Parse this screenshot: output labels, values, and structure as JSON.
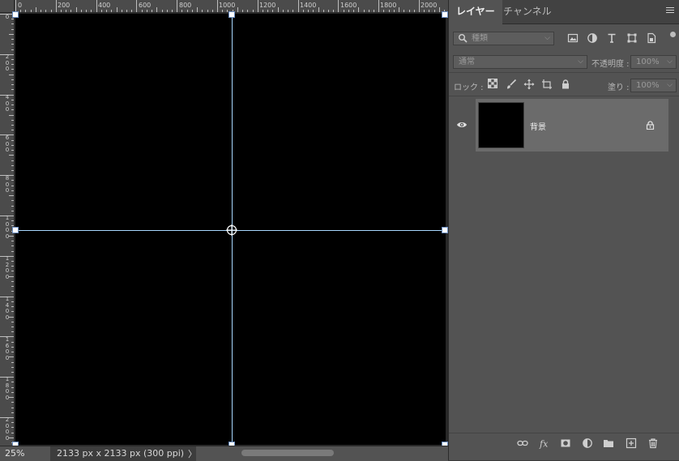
{
  "rulers": {
    "top_ticks": [
      "0",
      "200",
      "400",
      "600",
      "800",
      "1000",
      "1200",
      "1400",
      "1600",
      "1800",
      "2000"
    ],
    "left_ticks": [
      "0",
      "200",
      "400",
      "600",
      "800",
      "1000",
      "1200",
      "1400",
      "1600",
      "1800",
      "2000"
    ]
  },
  "status_bar": {
    "zoom": "25%",
    "doc_info": "2133 px x 2133 px (300 ppi)",
    "arrow": "〉"
  },
  "panel": {
    "tabs": [
      {
        "label": "レイヤー",
        "active": true
      },
      {
        "label": "チャンネル",
        "active": false
      }
    ],
    "filter": {
      "label": "種類",
      "icon": "search-icon"
    },
    "blend_mode": "通常",
    "opacity_label": "不透明度 :",
    "opacity_value": "100%",
    "lock_label": "ロック :",
    "fill_label": "塗り :",
    "fill_value": "100%",
    "layers": [
      {
        "name": "背景",
        "visible": true,
        "locked": true
      }
    ]
  },
  "colors": {
    "guide": "#a8d8ff",
    "canvas": "#000000",
    "panel_bg": "#535353",
    "selected_layer": "#6b6b6b"
  }
}
